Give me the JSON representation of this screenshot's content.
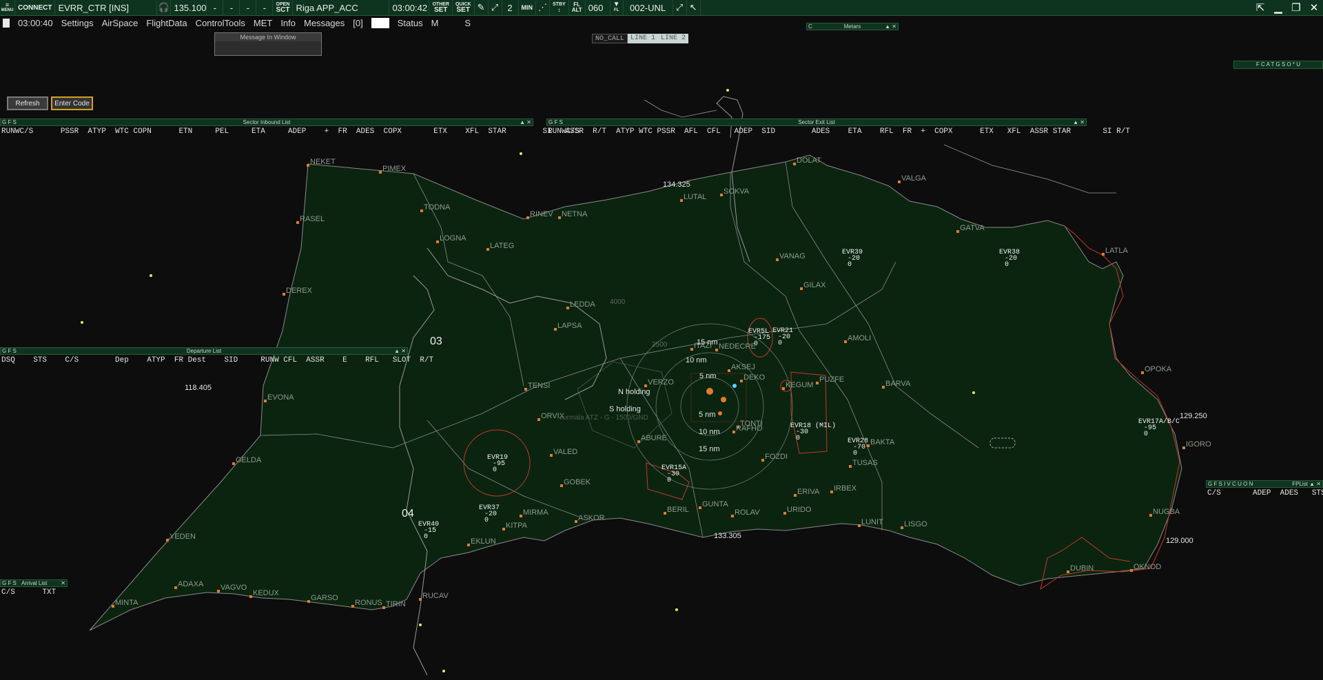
{
  "topbar": {
    "menu_label": "MENU",
    "connect_label": "CONNECT",
    "callsign": "EVRR_CTR [INS]",
    "frequency": "135.100",
    "dashes": [
      "-",
      "-",
      "-",
      "-"
    ],
    "open_sct_line1": "OPEN",
    "open_sct_line2": "SCT",
    "sector_name": "Riga APP_ACC",
    "utc_time": "03:00:42",
    "other_set_line1": "OTHER",
    "other_set_line2": "SET",
    "quick_set_line1": "QUICK",
    "quick_set_line2": "SET",
    "count": "2",
    "min_label": "MIN",
    "stby_line1": "STBY",
    "fl_alt_line1": "FL",
    "fl_alt_line2": "ALT",
    "transition_level": "060",
    "fl_label": "FL",
    "level_filter": "002-UNL"
  },
  "menubar": {
    "clock": "03:00:40",
    "items": [
      "Settings",
      "AirSpace",
      "FlightData",
      "ControlTools",
      "MET",
      "Info",
      "Messages",
      "[0]"
    ],
    "status": "Status",
    "m": "M",
    "s": "S"
  },
  "message_window": {
    "title": "Message In Window"
  },
  "metars": {
    "c": "C",
    "title": "Metars"
  },
  "call_lines": [
    "NO_CALL",
    "LINE 1",
    "LINE 2"
  ],
  "filters_right": "F C A T G S O * U",
  "buttons": {
    "refresh": "Refresh",
    "enter_code": "Enter Code"
  },
  "sector_inbound": {
    "title": "Sector Inbound List",
    "flags": "G F S",
    "header": "RUNWC/S      PSSR  ATYP  WTC COPN      ETN     PEL     ETA     ADEP    +  FR  ADES  COPX       ETX    XFL  STAR        SI   ASSR  R/T"
  },
  "sector_exit": {
    "title": "Sector Exit List",
    "flags": "G F S",
    "header": "RUNWC/S        ATYP WTC PSSR  AFL  CFL   ADEP  SID        ADES    ETA    RFL  FR  +  COPX      ETX   XFL  ASSR STAR       SI R/T"
  },
  "departure_list": {
    "title": "Departure List",
    "flags": "G F S",
    "header": "DSQ    STS    C/S        Dep    ATYP  FR Dest    SID     RUNW CFL  ASSR    E    RFL   SLOT  R/T"
  },
  "arrival_list": {
    "title": "Arrival List",
    "flags": "G F S",
    "header": "C/S      TXT"
  },
  "fp_list": {
    "title": "FPList",
    "flags": "G F S I V C U O N",
    "header": "C/S       ADEP  ADES   STS"
  },
  "map": {
    "waypoints": [
      "NEKET",
      "PIMEX",
      "TODNA",
      "RASEL",
      "LOGNA",
      "LATEG",
      "RINEV",
      "NETNA",
      "LUTAL",
      "SOKVA",
      "DOLAT",
      "VALGA",
      "GATVA",
      "LATLA",
      "VANAG",
      "GILAX",
      "AMOLI",
      "BARVA",
      "DEREX",
      "LEDDA",
      "LAPSA",
      "TENSI",
      "EVONA",
      "GELDA",
      "ORVIX",
      "VALED",
      "GOBEK",
      "ASKOR",
      "MIRMA",
      "KITPA",
      "EKLUN",
      "BERIL",
      "GUNTA",
      "ROLAV",
      "URIDO",
      "ERIVA",
      "IRBEX",
      "LUNIT",
      "LISGO",
      "PUZFE",
      "TUSAS",
      "BAKTA",
      "FOZDI",
      "TONTI",
      "YEDEN",
      "ADAXA",
      "VAGVO",
      "KEDUX",
      "GARSO",
      "RONUS",
      "TIRIN",
      "RUCAV",
      "MINTA",
      "OPOKA",
      "IGORO",
      "NUGBA",
      "OKNOD",
      "DUBIN",
      "ITAZI",
      "KEGUM",
      "VERZO",
      "ABURE",
      "RAFHO",
      "AKSEJ",
      "DEKO",
      "NEDECRE"
    ],
    "frequencies": [
      "134.325",
      "118.405",
      "133.305",
      "129.250",
      "129.000"
    ],
    "altitudes": [
      "4000",
      "2500"
    ],
    "rings": [
      "15 nm",
      "10 nm",
      "5 nm",
      "5 nm",
      "10 nm",
      "15 nm"
    ],
    "holdings": [
      "N holding",
      "S holding"
    ],
    "atz": "Jurmala ATZ - G - 1500/GND",
    "areas": [
      {
        "name": "EVR39",
        "line2": "20",
        "line3": "0"
      },
      {
        "name": "EVR38",
        "line2": "20",
        "line3": "0"
      },
      {
        "name": "EVR5L",
        "line2": "175",
        "line3": "0"
      },
      {
        "name": "EVR21",
        "line2": "20",
        "line3": "0"
      },
      {
        "name": "EVR18 (MIL)",
        "line2": "30",
        "line3": "0"
      },
      {
        "name": "EVR28",
        "line2": "70",
        "line3": "0"
      },
      {
        "name": "EVR17A/B/C",
        "line2": "95",
        "line3": "0"
      },
      {
        "name": "EVR19",
        "line2": "95",
        "line3": "0"
      },
      {
        "name": "EVR15A",
        "line2": "30",
        "line3": "0"
      },
      {
        "name": "EVR37",
        "line2": "20",
        "line3": "0"
      },
      {
        "name": "EVR40",
        "line2": "15",
        "line3": "0"
      }
    ],
    "airfield_ids": [
      "03",
      "04"
    ],
    "colors": {
      "land": "#0b2410",
      "border": "#a8a8a8",
      "fix": "#e07c30",
      "restricted": "#c0392b"
    }
  }
}
